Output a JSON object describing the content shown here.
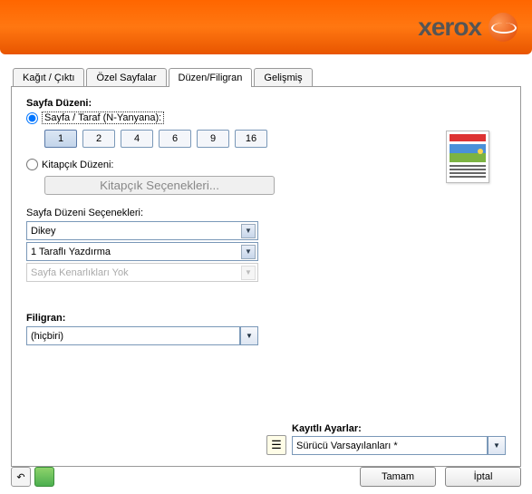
{
  "brand": "xerox",
  "tabs": [
    {
      "label": "Kağıt / Çıktı"
    },
    {
      "label": "Özel Sayfalar"
    },
    {
      "label": "Düzen/Filigran"
    },
    {
      "label": "Gelişmiş"
    }
  ],
  "sayfa_duzeni_title": "Sayfa Düzeni:",
  "radio_nup": "Sayfa / Taraf (N-Yanyana):",
  "nup_values": [
    "1",
    "2",
    "4",
    "6",
    "9",
    "16"
  ],
  "radio_kitapcik": "Kitapçık Düzeni:",
  "kitapcik_btn": "Kitapçık Seçenekleri...",
  "options_label": "Sayfa Düzeni Seçenekleri:",
  "orientation": "Dikey",
  "sides": "1 Taraflı Yazdırma",
  "borders": "Sayfa Kenarlıkları Yok",
  "filigran_label": "Filigran:",
  "filigran_value": "(hiçbiri)",
  "saved_label": "Kayıtlı Ayarlar:",
  "saved_value": "Sürücü Varsayılanları *",
  "ok_btn": "Tamam",
  "cancel_btn": "İptal"
}
